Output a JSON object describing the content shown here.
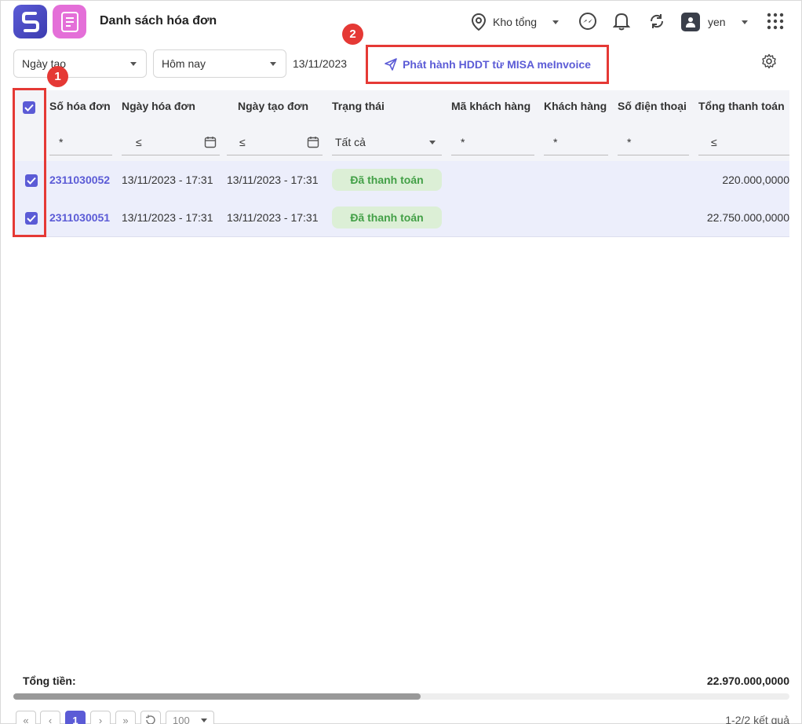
{
  "header": {
    "title": "Danh sách hóa đơn",
    "warehouse": "Kho tổng",
    "username": "yen"
  },
  "filters": {
    "date_type": "Ngày tạo",
    "date_range": "Hôm nay",
    "date_value": "13/11/2023",
    "publish_button": "Phát hành HDDT từ MISA meInvoice"
  },
  "annotations": {
    "step1": "1",
    "step2": "2"
  },
  "table": {
    "columns": [
      "Số hóa đơn",
      "Ngày hóa đơn",
      "Ngày tạo đơn",
      "Trạng thái",
      "Mã khách hàng",
      "Khách hàng",
      "Số điện thoại",
      "Tổng thanh toán"
    ],
    "column_filters": {
      "invoice_no": "*",
      "invoice_date": "≤",
      "created_date": "≤",
      "status": "Tất cả",
      "customer_code": "*",
      "customer": "*",
      "phone": "*",
      "total": "≤"
    },
    "rows": [
      {
        "invoice_no": "2311030052",
        "invoice_date": "13/11/2023 - 17:31",
        "created_date": "13/11/2023 - 17:31",
        "status": "Đã thanh toán",
        "total": "220.000,0000",
        "checked": true
      },
      {
        "invoice_no": "2311030051",
        "invoice_date": "13/11/2023 - 17:31",
        "created_date": "13/11/2023 - 17:31",
        "status": "Đã thanh toán",
        "total": "22.750.000,0000",
        "checked": true
      }
    ]
  },
  "footer": {
    "total_label": "Tổng tiền:",
    "total_value": "22.970.000,0000",
    "pagination": {
      "first": "«",
      "prev": "‹",
      "current_page": "1",
      "next": "›",
      "last": "»",
      "page_size": "100"
    },
    "result_count": "1-2/2 kết quả"
  },
  "colors": {
    "accent": "#5b5bd6",
    "highlight": "#e53935",
    "status_paid": "#43a047"
  }
}
